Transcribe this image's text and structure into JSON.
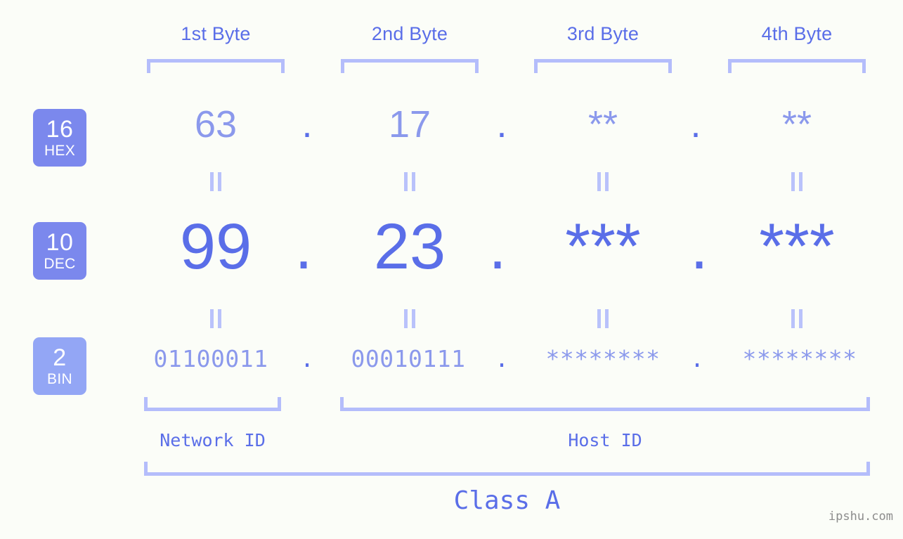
{
  "background_color": "#fbfdf8",
  "accent_color": "#5a6ee8",
  "accent_light_color": "#8b99ec",
  "bracket_color": "#b4bdfb",
  "headers": [
    {
      "label": "1st Byte"
    },
    {
      "label": "2nd Byte"
    },
    {
      "label": "3rd Byte"
    },
    {
      "label": "4th Byte"
    }
  ],
  "bases": [
    {
      "number": "16",
      "abbr": "HEX",
      "badge_color": "#7b88ed"
    },
    {
      "number": "10",
      "abbr": "DEC",
      "badge_color": "#7b88ed"
    },
    {
      "number": "2",
      "abbr": "BIN",
      "badge_color": "#93a6f5"
    }
  ],
  "rows": {
    "hex": {
      "base_number": "16",
      "base_abbr": "HEX",
      "octets": [
        "63",
        "17",
        "**",
        "**"
      ],
      "separator": "."
    },
    "dec": {
      "base_number": "10",
      "base_abbr": "DEC",
      "octets": [
        "99",
        "23",
        "***",
        "***"
      ],
      "separator": "."
    },
    "bin": {
      "base_number": "2",
      "base_abbr": "BIN",
      "octets": [
        "01100011",
        "00010111",
        "********",
        "********"
      ],
      "separator": "."
    }
  },
  "equality_mark": "=",
  "footer": {
    "network_id_label": "Network ID",
    "host_id_label": "Host ID",
    "class_label": "Class A",
    "watermark": "ipshu.com"
  }
}
